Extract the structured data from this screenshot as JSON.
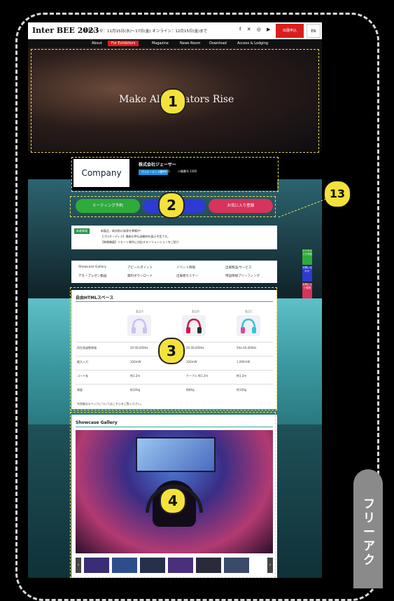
{
  "header": {
    "logo": "Inter BEE 2023",
    "dates": "幕張メッセ：11月15日(水)〜17日(金) オンライン：12月15日(金)まで",
    "social": "f ✕ ◎ ▶",
    "register_label": "出展申込",
    "lang_label": "EN"
  },
  "nav": {
    "items": [
      "About",
      "For Exhibitors",
      "Magazine",
      "News Room",
      "Download",
      "Access & Lodging"
    ]
  },
  "hero": {
    "tagline": "Make All Creators Rise"
  },
  "company": {
    "logo_text": "Company",
    "name": "株式会社ジェーサー",
    "category": "プロオーディオ部門",
    "hall": "ホール1",
    "booth": "小間番号 2305"
  },
  "actions": {
    "meeting": "ミーティング予約",
    "contact": "",
    "favorite": "お気に入り登録"
  },
  "notice": {
    "tag": "新着情報",
    "line1": "新製品・新技術の発表を準備中！",
    "line2": "【プロオーディオ】最新のIP伝送機材を展示予定です。",
    "line3": "【映像機器】リモート制作に対応するソリューションをご紹介"
  },
  "menu": {
    "items": [
      "Showcase Gallery",
      "アピールポイント",
      "イベント情報",
      "出展製品/サービス",
      "デモ・プレゼン動画",
      "資料ダウンロード",
      "出展者セミナー",
      "特設情報ブリーフィング"
    ]
  },
  "table": {
    "title": "自由HTMLスペース",
    "headers": [
      "製品A",
      "製品B",
      "製品C"
    ],
    "colors": [
      "#c7c2ef",
      "#d3184a",
      "#37c4d3"
    ],
    "rows": [
      {
        "label": "再生周波数帯域",
        "a": "20-40,000Hz",
        "b": "20-40,000Hz",
        "c": "5Hz-40,000Hz"
      },
      {
        "label": "最大入力",
        "a": "100mW",
        "b": "100mW",
        "c": "1,000mW"
      },
      {
        "label": "コード長",
        "a": "約1.2m",
        "b": "ケーブル 約1.2m",
        "c": "約1.2m"
      },
      {
        "label": "質量",
        "a": "約100g",
        "b": "約80g",
        "c": "約100g"
      }
    ],
    "footnote": "※詳細はスペックについてはこちらをご覧ください。"
  },
  "gallery": {
    "title": "Showcase Gallery"
  },
  "side_buttons": [
    "ミーティング予約",
    "お問い合わせ",
    "お気に入り登録"
  ],
  "annotations": {
    "n1": "1",
    "n2": "2",
    "n3": "3",
    "n4": "4",
    "n13": "13"
  },
  "side_tab": {
    "label": "フリーアク"
  }
}
